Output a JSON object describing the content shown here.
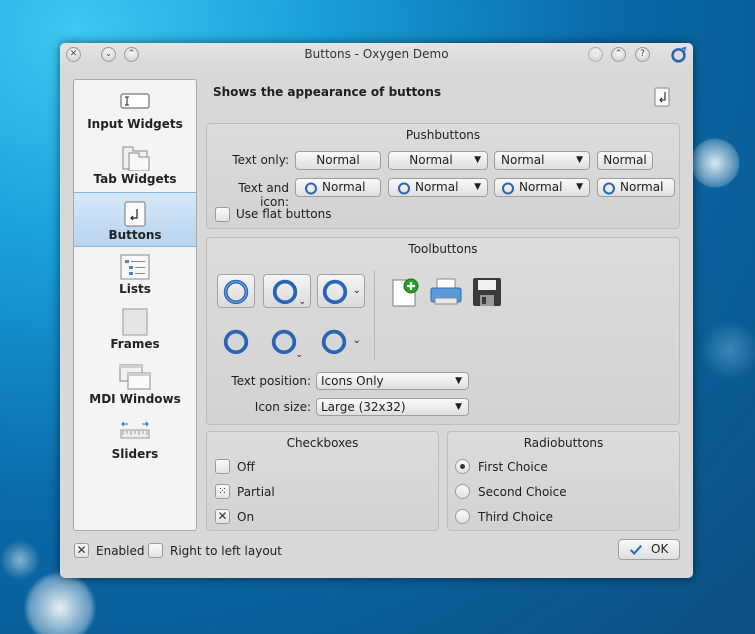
{
  "window": {
    "title": "Buttons - Oxygen Demo"
  },
  "sidebar": {
    "items": [
      {
        "label": "Input Widgets"
      },
      {
        "label": "Tab Widgets"
      },
      {
        "label": "Buttons",
        "selected": true
      },
      {
        "label": "Lists"
      },
      {
        "label": "Frames"
      },
      {
        "label": "MDI Windows"
      },
      {
        "label": "Sliders"
      }
    ]
  },
  "page": {
    "heading": "Shows the appearance of buttons"
  },
  "pushbuttons": {
    "title": "Pushbuttons",
    "text_only_label": "Text only:",
    "text_and_icon_label": "Text and icon:",
    "button_label": "Normal",
    "flat_label": "Use flat buttons"
  },
  "toolbuttons": {
    "title": "Toolbuttons",
    "text_position_label": "Text position:",
    "text_position_value": "Icons Only",
    "icon_size_label": "Icon size:",
    "icon_size_value": "Large (32x32)"
  },
  "checkboxes": {
    "title": "Checkboxes",
    "items": [
      {
        "label": "Off",
        "state": "off"
      },
      {
        "label": "Partial",
        "state": "partial"
      },
      {
        "label": "On",
        "state": "on"
      }
    ]
  },
  "radiobuttons": {
    "title": "Radiobuttons",
    "items": [
      {
        "label": "First Choice",
        "checked": true
      },
      {
        "label": "Second Choice",
        "checked": false
      },
      {
        "label": "Third Choice",
        "checked": false
      }
    ]
  },
  "footer": {
    "enabled_label": "Enabled",
    "rtl_label": "Right to left layout",
    "ok_label": "OK"
  },
  "colors": {
    "accent": "#2f6fbf",
    "selection": "#b6d3ef",
    "window_bg": "#d8d8d8"
  }
}
